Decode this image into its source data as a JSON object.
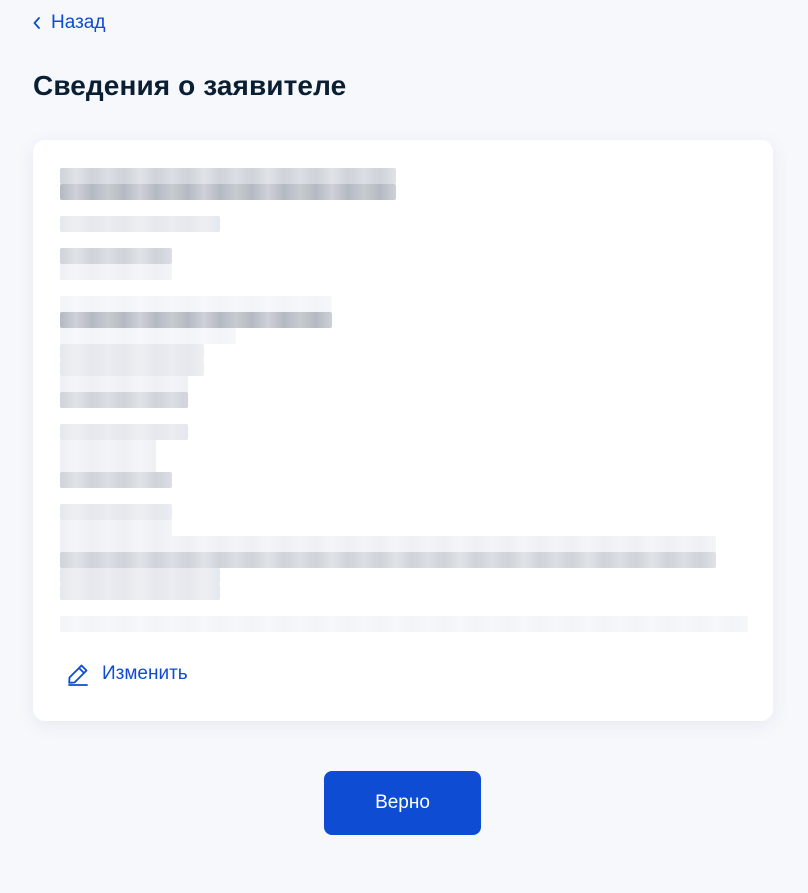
{
  "nav": {
    "back_label": "Назад"
  },
  "page": {
    "title": "Сведения о заявителе"
  },
  "card": {
    "edit_label": "Изменить"
  },
  "actions": {
    "confirm_label": "Верно"
  },
  "colors": {
    "accent": "#0d4cd3",
    "background": "#f6f8fc",
    "card": "#ffffff",
    "text": "#0b1f33"
  },
  "icons": {
    "back": "chevron-left-icon",
    "edit": "pencil-icon"
  }
}
